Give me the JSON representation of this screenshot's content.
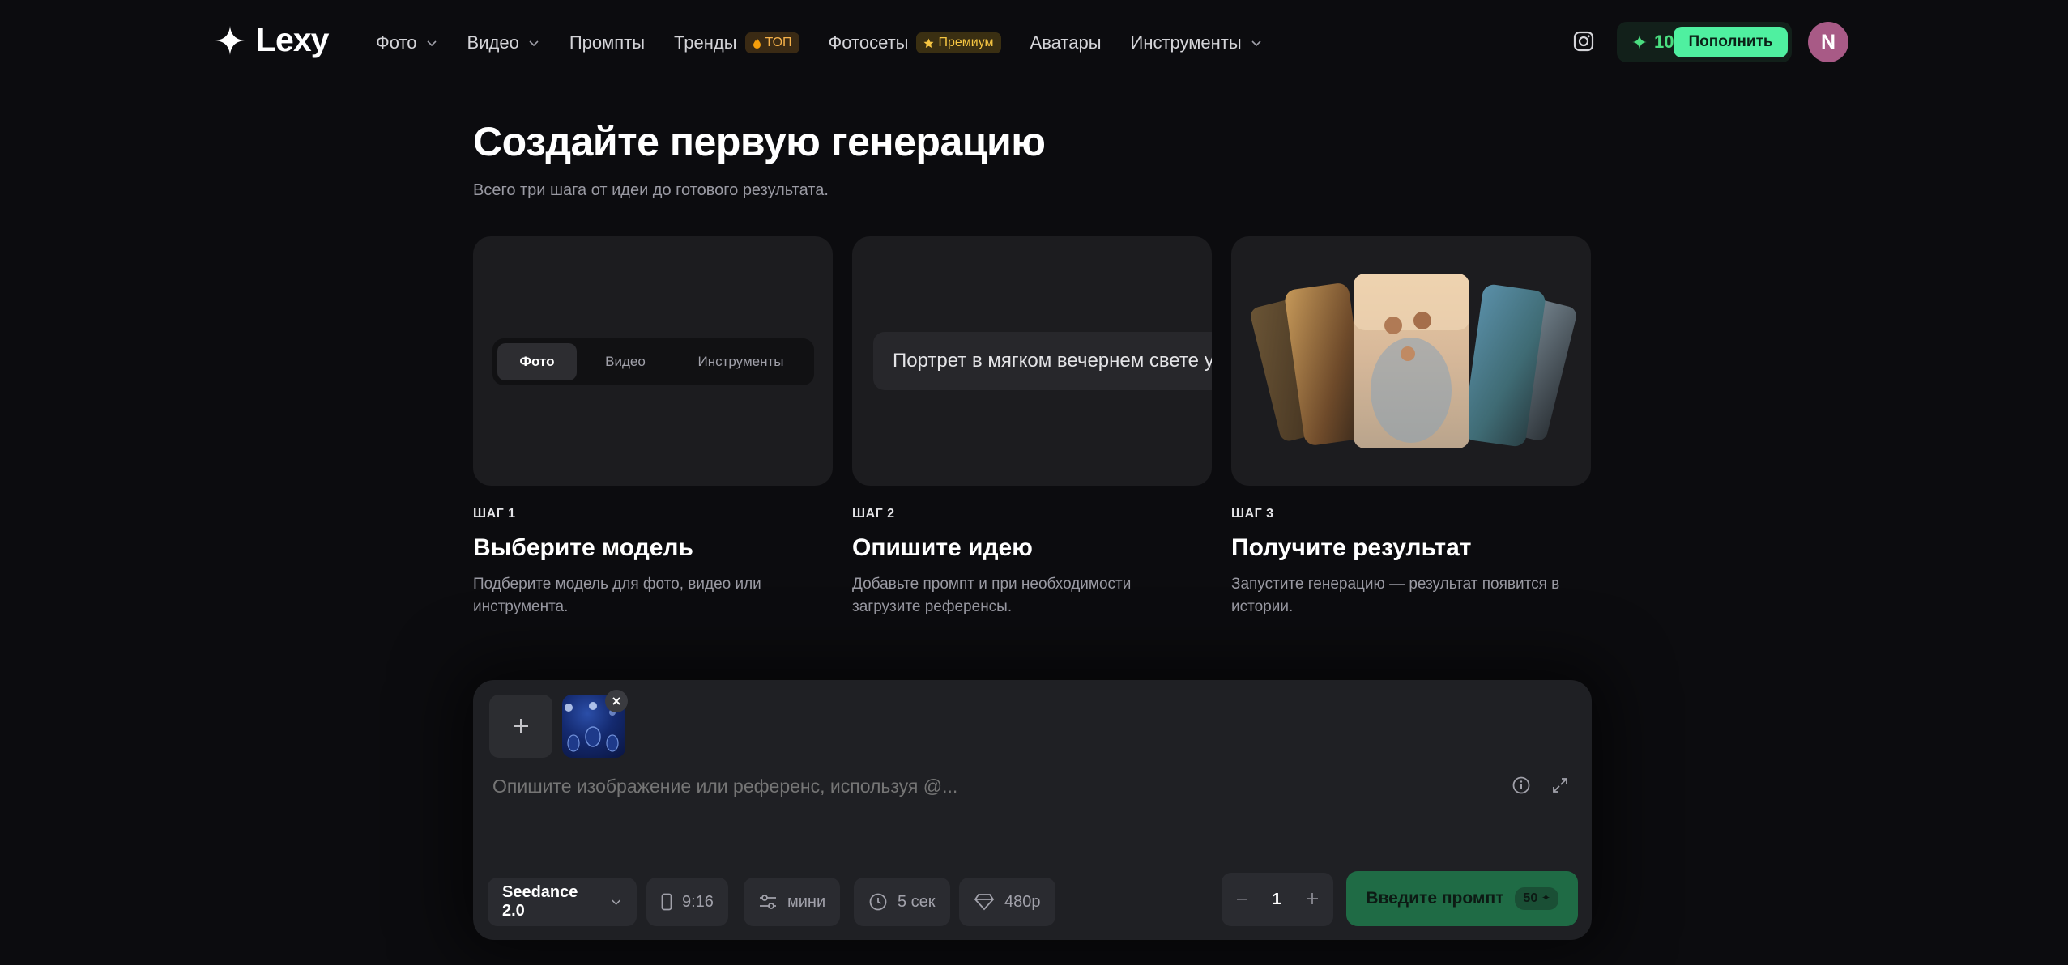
{
  "brand": {
    "name": "Lexy"
  },
  "nav": {
    "items": [
      {
        "label": "Фото",
        "dropdown": true
      },
      {
        "label": "Видео",
        "dropdown": true
      },
      {
        "label": "Промпты",
        "dropdown": false
      },
      {
        "label": "Тренды",
        "badge": "ТОП"
      },
      {
        "label": "Фотосеты",
        "badge": "Премиум"
      },
      {
        "label": "Аватары",
        "dropdown": false
      },
      {
        "label": "Инструменты",
        "dropdown": true
      }
    ]
  },
  "account": {
    "credits": "10",
    "topup_label": "Пополнить",
    "avatar_initial": "N"
  },
  "hero": {
    "title": "Создайте первую генерацию",
    "subtitle": "Всего три шага от идеи до готового результата."
  },
  "steps": [
    {
      "label": "ШАГ 1",
      "title": "Выберите модель",
      "desc": "Подберите модель для фото, видео или инструмента.",
      "segments": [
        "Фото",
        "Видео",
        "Инструменты"
      ],
      "active_segment": "Фото"
    },
    {
      "label": "ШАГ 2",
      "title": "Опишите идею",
      "desc": "Добавьте промпт и при необходимости загрузите референсы.",
      "example_prompt": "Портрет в мягком вечернем свете у"
    },
    {
      "label": "ШАГ 3",
      "title": "Получите результат",
      "desc": "Запустите генерацию — результат появится в истории."
    }
  ],
  "composer": {
    "placeholder": "Опишите изображение или референс, используя @...",
    "model": "Seedance 2.0",
    "aspect": "9:16",
    "mode": "мини",
    "duration": "5 сек",
    "resolution": "480p",
    "quantity": "1",
    "submit_label": "Введите промпт",
    "cost": "50"
  },
  "colors": {
    "accent": "#4ff0a0",
    "bg": "#0c0c0f",
    "card": "#1c1c1f"
  }
}
